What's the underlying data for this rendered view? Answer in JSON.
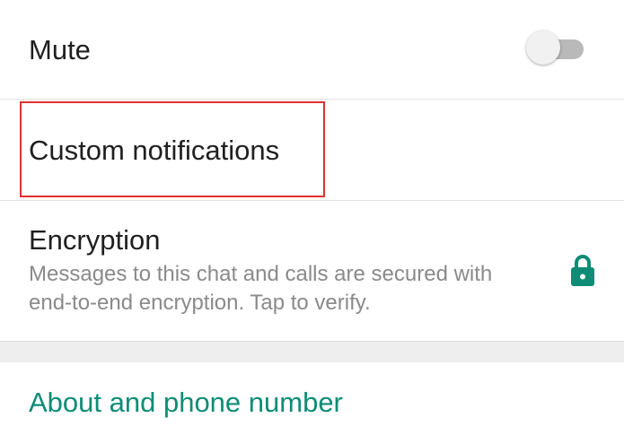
{
  "colors": {
    "accent": "#0e8c75",
    "highlight": "#e0312f",
    "divider": "#e0e0e0"
  },
  "settings": {
    "mute": {
      "label": "Mute",
      "toggle_on": false
    },
    "custom_notifications": {
      "label": "Custom notifications"
    },
    "encryption": {
      "label": "Encryption",
      "description": "Messages to this chat and calls are secured with end-to-end encryption. Tap to verify.",
      "icon": "lock-icon"
    },
    "about": {
      "label": "About and phone number"
    }
  }
}
